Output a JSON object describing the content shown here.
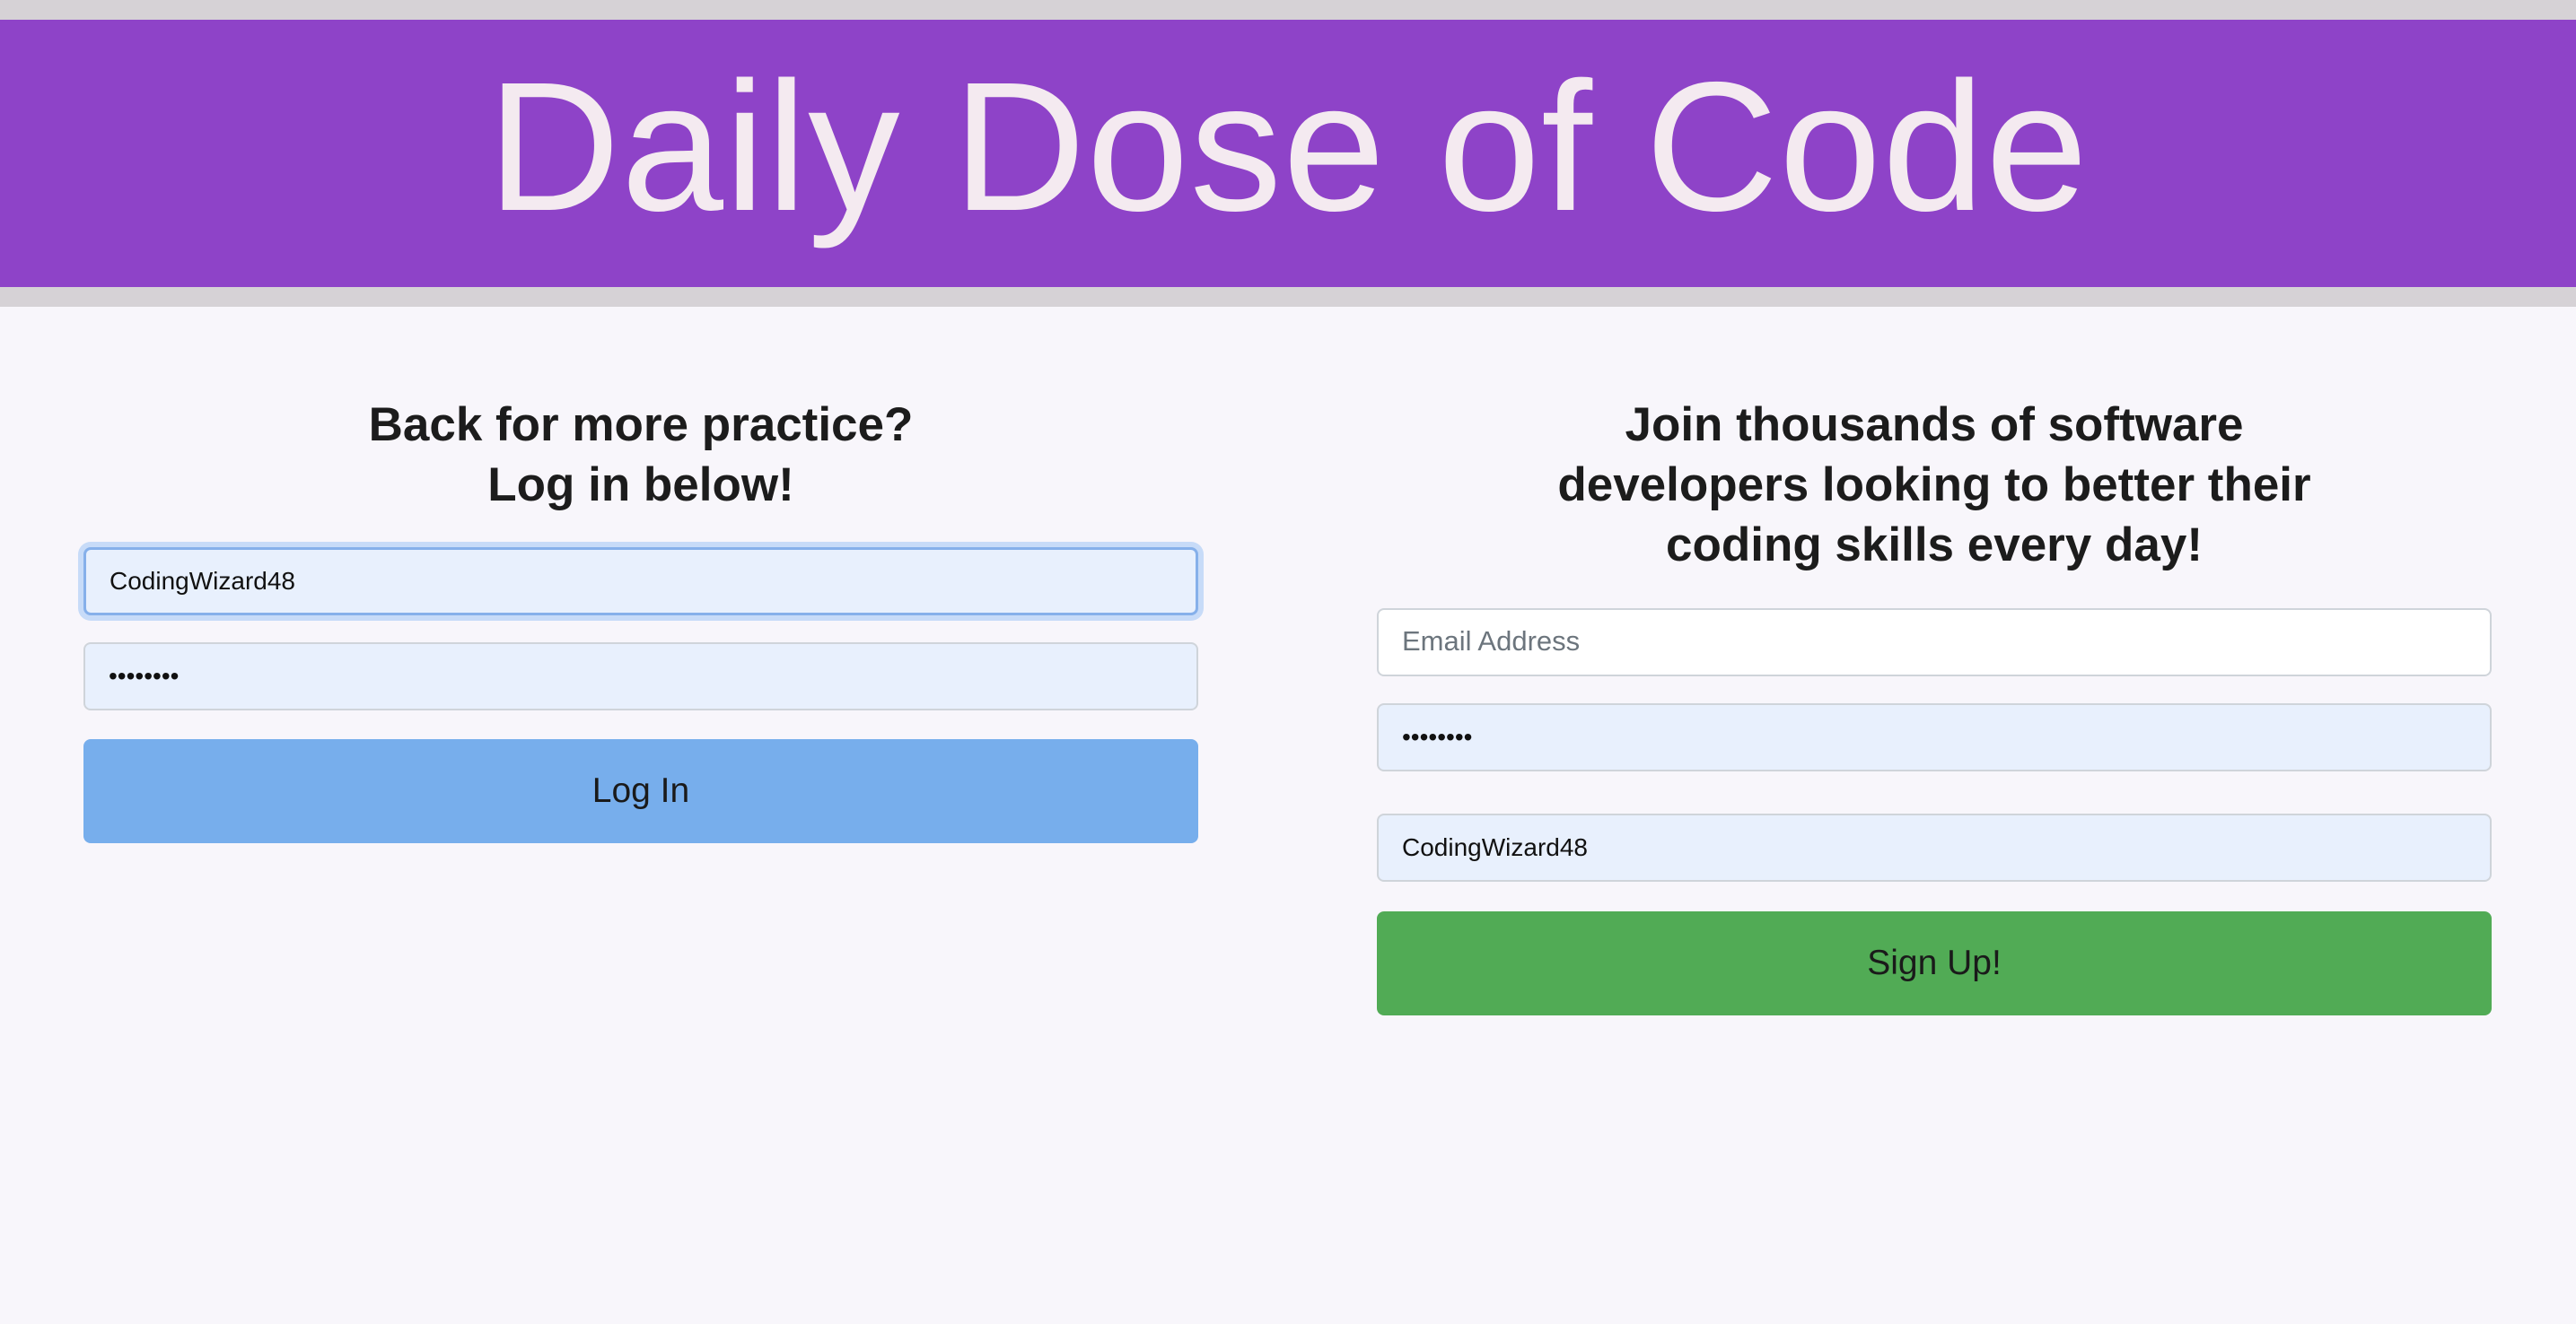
{
  "header": {
    "title": "Daily Dose of Code"
  },
  "login": {
    "heading_line1": "Back for more practice?",
    "heading_line2": "Log in below!",
    "username_value": "CodingWizard48",
    "password_value": "••••••••",
    "button_label": "Log In"
  },
  "signup": {
    "heading_line1": "Join thousands of software",
    "heading_line2": "developers looking to better their",
    "heading_line3": "coding skills every day!",
    "email_placeholder": "Email Address",
    "email_value": "",
    "password_value": "••••••••",
    "username_value": "CodingWizard48",
    "button_label": "Sign Up!"
  },
  "colors": {
    "banner": "#8e43c8",
    "banner_text": "#f4eaf0",
    "login_button": "#77aeec",
    "signup_button": "#51ab55",
    "background": "#f8f6fb"
  }
}
